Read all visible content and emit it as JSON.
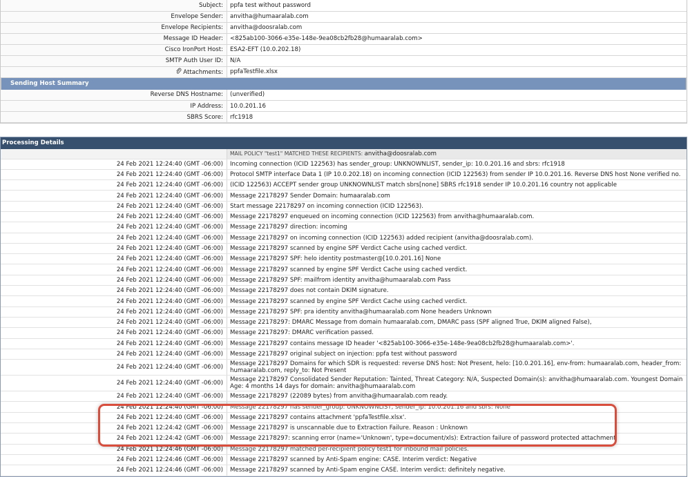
{
  "message_info": [
    {
      "label": "Subject:",
      "value": "ppfa test without password"
    },
    {
      "label": "Envelope Sender:",
      "value": "anvitha@humaaralab.com"
    },
    {
      "label": "Envelope Recipients:",
      "value": "anvitha@doosralab.com"
    },
    {
      "label": "Message ID Header:",
      "value": "<825ab100-3066-e35e-148e-9ea08cb2fb28@humaaralab.com>"
    },
    {
      "label": "Cisco IronPort Host:",
      "value": "ESA2-EFT (10.0.202.18)"
    },
    {
      "label": "SMTP Auth User ID:",
      "value": "N/A"
    },
    {
      "label": "Attachments:",
      "value": "ppfaTestfile.xlsx"
    }
  ],
  "sending_host_summary": {
    "title": "Sending Host Summary",
    "rows": [
      {
        "label": "Reverse DNS Hostname:",
        "value": "(unverified)"
      },
      {
        "label": "IP Address:",
        "value": "10.0.201.16"
      },
      {
        "label": "SBRS Score:",
        "value": "rfc1918"
      }
    ]
  },
  "processing_details": {
    "title": "Processing Details",
    "policy_prefix": "MAIL POLICY \"test1\" MATCHED THESE RECIPIENTS:",
    "policy_recipient": "anvitha@doosralab.com",
    "rows": [
      {
        "time": "24 Feb 2021 12:24:40 (GMT -06:00)",
        "text": "Incoming connection (ICID 122563) has sender_group: UNKNOWNLIST, sender_ip: 10.0.201.16 and sbrs: rfc1918"
      },
      {
        "time": "24 Feb 2021 12:24:40 (GMT -06:00)",
        "text": "Protocol SMTP interface Data 1 (IP 10.0.202.18) on incoming connection (ICID 122563) from sender IP 10.0.201.16. Reverse DNS host None verified no."
      },
      {
        "time": "24 Feb 2021 12:24:40 (GMT -06:00)",
        "text": "(ICID 122563) ACCEPT sender group UNKNOWNLIST match sbrs[none] SBRS rfc1918 sender IP 10.0.201.16 country not applicable"
      },
      {
        "time": "24 Feb 2021 12:24:40 (GMT -06:00)",
        "text": "Message 22178297 Sender Domain: humaaralab.com"
      },
      {
        "time": "24 Feb 2021 12:24:40 (GMT -06:00)",
        "text": "Start message 22178297 on incoming connection (ICID 122563)."
      },
      {
        "time": "24 Feb 2021 12:24:40 (GMT -06:00)",
        "text": "Message 22178297 enqueued on incoming connection (ICID 122563) from anvitha@humaaralab.com."
      },
      {
        "time": "24 Feb 2021 12:24:40 (GMT -06:00)",
        "text": "Message 22178297 direction: incoming"
      },
      {
        "time": "24 Feb 2021 12:24:40 (GMT -06:00)",
        "text": "Message 22178297 on incoming connection (ICID 122563) added recipient (anvitha@doosralab.com)."
      },
      {
        "time": "24 Feb 2021 12:24:40 (GMT -06:00)",
        "text": "Message 22178297 scanned by engine SPF Verdict Cache using cached verdict."
      },
      {
        "time": "24 Feb 2021 12:24:40 (GMT -06:00)",
        "text": "Message 22178297 SPF: helo identity postmaster@[10.0.201.16] None"
      },
      {
        "time": "24 Feb 2021 12:24:40 (GMT -06:00)",
        "text": "Message 22178297 scanned by engine SPF Verdict Cache using cached verdict."
      },
      {
        "time": "24 Feb 2021 12:24:40 (GMT -06:00)",
        "text": "Message 22178297 SPF: mailfrom identity anvitha@humaaralab.com Pass"
      },
      {
        "time": "24 Feb 2021 12:24:40 (GMT -06:00)",
        "text": "Message 22178297 does not contain DKIM signature."
      },
      {
        "time": "24 Feb 2021 12:24:40 (GMT -06:00)",
        "text": "Message 22178297 scanned by engine SPF Verdict Cache using cached verdict."
      },
      {
        "time": "24 Feb 2021 12:24:40 (GMT -06:00)",
        "text": "Message 22178297 SPF: pra identity anvitha@humaaralab.com None headers Unknown"
      },
      {
        "time": "24 Feb 2021 12:24:40 (GMT -06:00)",
        "text": "Message 22178297: DMARC Message from domain humaaralab.com, DMARC pass (SPF aligned True, DKIM aligned False),"
      },
      {
        "time": "24 Feb 2021 12:24:40 (GMT -06:00)",
        "text": "Message 22178297: DMARC verification passed."
      },
      {
        "time": "24 Feb 2021 12:24:40 (GMT -06:00)",
        "text": "Message 22178297 contains message ID header '<825ab100-3066-e35e-148e-9ea08cb2fb28@humaaralab.com>'."
      },
      {
        "time": "24 Feb 2021 12:24:40 (GMT -06:00)",
        "text": "Message 22178297 original subject on injection: ppfa test without password"
      },
      {
        "time": "24 Feb 2021 12:24:40 (GMT -06:00)",
        "text": "Message 22178297 Domains for which SDR is requested: reverse DNS host: Not Present, helo: [10.0.201.16], env-from: humaaralab.com, header_from: humaaralab.com, reply_to: Not Present",
        "wrapped": true
      },
      {
        "time": "24 Feb 2021 12:24:40 (GMT -06:00)",
        "text": "Message 22178297 Consolidated Sender Reputation: Tainted, Threat Category: N/A, Suspected Domain(s): anvitha@humaaralab.com. Youngest Domain Age: 4 months 14 days for domain: anvitha@humaaralab.com",
        "wrapped": true
      },
      {
        "time": "24 Feb 2021 12:24:40 (GMT -06:00)",
        "text": "Message 22178297 (22089 bytes) from anvitha@humaaralab.com ready."
      },
      {
        "time": "24 Feb 2021 12:24:40 (GMT -06:00)",
        "text": "Message 22178297 has sender_group: UNKNOWNLIST, sender_ip: 10.0.201.16 and sbrs: None",
        "cut": true
      },
      {
        "time": "24 Feb 2021 12:24:40 (GMT -06:00)",
        "text": "Message 22178297 contains attachment 'ppfaTestfile.xlsx'."
      },
      {
        "time": "24 Feb 2021 12:24:42 (GMT -06:00)",
        "text": "Message 22178297 is unscannable due to Extraction Failure. Reason : Unknown"
      },
      {
        "time": "24 Feb 2021 12:24:42 (GMT -06:00)",
        "text": "Message 22178297: scanning error (name='Unknown', type=document/xls): Extraction failure of password protected attachment"
      },
      {
        "time": "24 Feb 2021 12:24:46 (GMT -06:00)",
        "text": "Message 22178297 matched per-recipient policy test1 for inbound mail policies.",
        "cut": true
      },
      {
        "time": "24 Feb 2021 12:24:46 (GMT -06:00)",
        "text": "Message 22178297 scanned by Anti-Spam engine: CASE. Interim verdict: Negative"
      },
      {
        "time": "24 Feb 2021 12:24:46 (GMT -06:00)",
        "text": "Message 22178297 scanned by Anti-Spam engine CASE. Interim verdict: definitely negative."
      }
    ]
  },
  "icons": {
    "attachment": "paperclip-icon"
  },
  "colors": {
    "section_bar": "#7793bb",
    "processing_header": "#37506d",
    "highlight": "#d84d3c"
  }
}
